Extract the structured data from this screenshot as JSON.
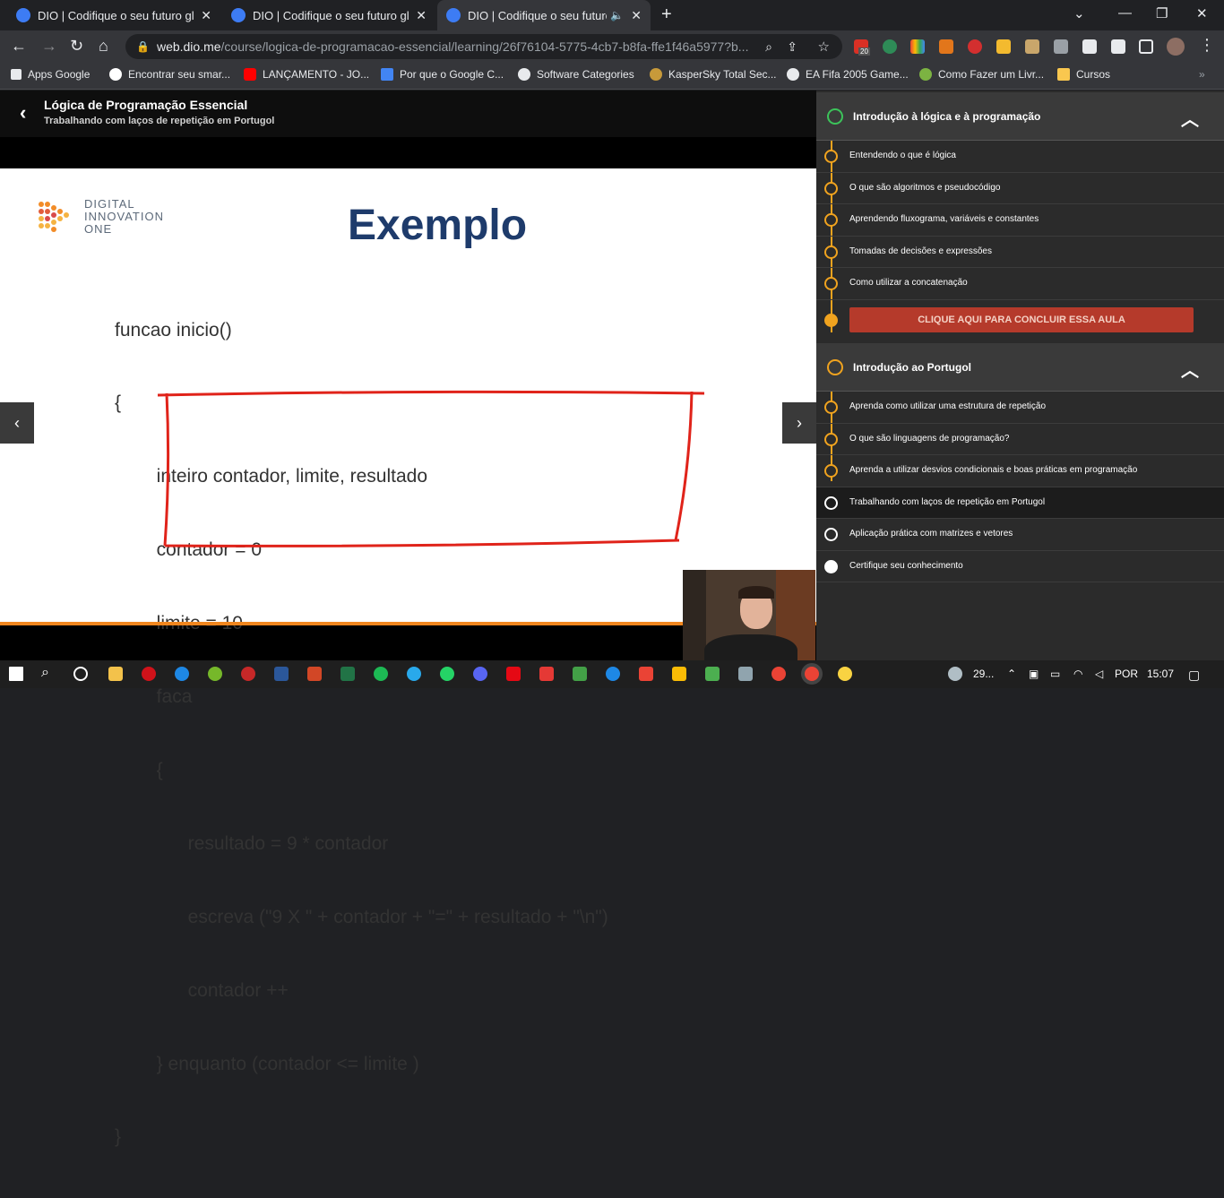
{
  "browser": {
    "tabs": [
      {
        "title": "DIO | Codifique o seu futuro glob"
      },
      {
        "title": "DIO | Codifique o seu futuro glob"
      },
      {
        "title": "DIO | Codifique o seu futuro"
      }
    ],
    "url_host": "web.dio.me",
    "url_path": "/course/logica-de-programacao-essencial/learning/26f76104-5775-4cb7-b8fa-ffe1f46a5977?b...",
    "bookmarks": [
      "Apps Google",
      "Encontrar seu smar...",
      "LANÇAMENTO - JO...",
      "Por que o Google C...",
      "Software Categories",
      "KasperSky Total Sec...",
      "EA Fifa 2005 Game...",
      "Como Fazer um Livr...",
      "Cursos"
    ],
    "ext_badge": "20"
  },
  "course": {
    "title": "Lógica de Programação Essencial",
    "subtitle": "Trabalhando com laços de repetição em Portugol"
  },
  "slide": {
    "brand": "DIGITAL INNOVATION ONE",
    "heading": "Exemplo",
    "code": [
      "funcao inicio()",
      "{",
      "        inteiro contador, limite, resultado",
      "        contador = 0",
      "        limite = 10",
      "        faca",
      "        {",
      "              resultado = 9 * contador",
      "              escreva (\"9 X \" + contador + \"=\" + resultado + \"\\n\")",
      "              contador ++",
      "        } enquanto (contador <= limite )",
      "}"
    ]
  },
  "sidebar": {
    "module1": {
      "title": "Introdução à lógica e à programação",
      "lessons": [
        "Entendendo o que é lógica",
        "O que são algoritmos e pseudocódigo",
        "Aprendendo fluxograma, variáveis e constantes",
        "Tomadas de decisões e expressões",
        "Como utilizar a concatenação"
      ],
      "cta": "CLIQUE AQUI PARA CONCLUIR ESSA AULA"
    },
    "module2": {
      "title": "Introdução ao Portugol",
      "lessons": [
        "Aprenda como utilizar uma estrutura de repetição",
        "O que são linguagens de programação?",
        "Aprenda a utilizar desvios condicionais e boas práticas em programação",
        "Trabalhando com laços de repetição em Portugol",
        "Aplicação prática com matrizes e vetores",
        "Certifique seu conhecimento"
      ]
    }
  },
  "taskbar": {
    "weather": "29...",
    "language": "POR",
    "time": "15:07"
  },
  "colors": {
    "accent_orange": "#f0a31f",
    "cta_red": "#b53a2b",
    "heading_navy": "#1e3b6b"
  }
}
